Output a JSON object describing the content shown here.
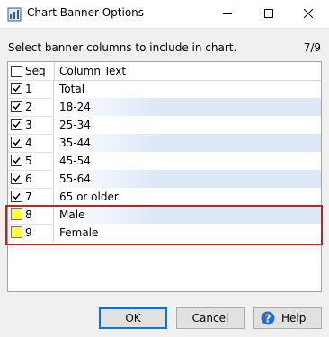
{
  "window": {
    "title": "Chart Banner Options",
    "icon": "chart-app-icon"
  },
  "prompt": "Select banner columns to include in chart.",
  "selection_count": "7/9",
  "table": {
    "columns": [
      "Seq",
      "Column Text"
    ],
    "rows": [
      {
        "seq": "1",
        "text": "Total",
        "checked": true
      },
      {
        "seq": "2",
        "text": "18-24",
        "checked": true
      },
      {
        "seq": "3",
        "text": "25-34",
        "checked": true
      },
      {
        "seq": "4",
        "text": "35-44",
        "checked": true
      },
      {
        "seq": "5",
        "text": "45-54",
        "checked": true
      },
      {
        "seq": "6",
        "text": "55-64",
        "checked": true
      },
      {
        "seq": "7",
        "text": "65 or older",
        "checked": true
      },
      {
        "seq": "8",
        "text": "Male",
        "checked": false
      },
      {
        "seq": "9",
        "text": "Female",
        "checked": false
      }
    ]
  },
  "buttons": {
    "ok": "OK",
    "cancel": "Cancel",
    "help": "Help"
  },
  "colors": {
    "accent": "#0078d7",
    "highlight_border": "#b02a2a",
    "alt_row": "#dce8f6",
    "unchecked_highlight": "#ffff33"
  }
}
